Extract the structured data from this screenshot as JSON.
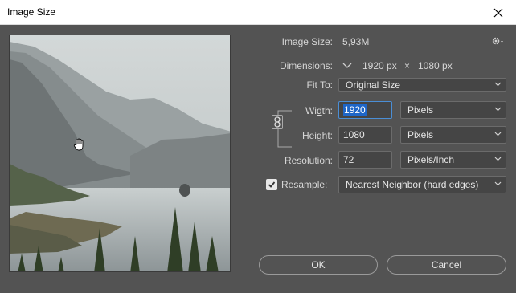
{
  "window": {
    "title": "Image Size"
  },
  "image_size": {
    "label": "Image Size:",
    "value": "5,93M"
  },
  "dimensions": {
    "label": "Dimensions:",
    "width": "1920 px",
    "times": "×",
    "height": "1080 px"
  },
  "fit_to": {
    "label": "Fit To:",
    "value": "Original Size"
  },
  "width": {
    "label_pre": "Wi",
    "label_u": "d",
    "label_post": "th:",
    "value": "1920",
    "unit": "Pixels"
  },
  "height": {
    "label_pre": "Hei",
    "label_u": "g",
    "label_post": "ht:",
    "value": "1080",
    "unit": "Pixels"
  },
  "resolution": {
    "label_u": "R",
    "label_post": "esolution:",
    "value": "72",
    "unit": "Pixels/Inch"
  },
  "resample": {
    "label_pre": "Re",
    "label_u": "s",
    "label_post": "ample:",
    "checked": true,
    "value": "Nearest Neighbor (hard edges)"
  },
  "buttons": {
    "ok": "OK",
    "cancel": "Cancel"
  },
  "colors": {
    "dialog_bg": "#535353",
    "field_bg": "#454545",
    "selection": "#1e66c8"
  },
  "icons": [
    "close-icon",
    "gear-icon",
    "chevron-down-icon",
    "link-icon",
    "checkmark-icon",
    "hand-cursor-icon"
  ]
}
